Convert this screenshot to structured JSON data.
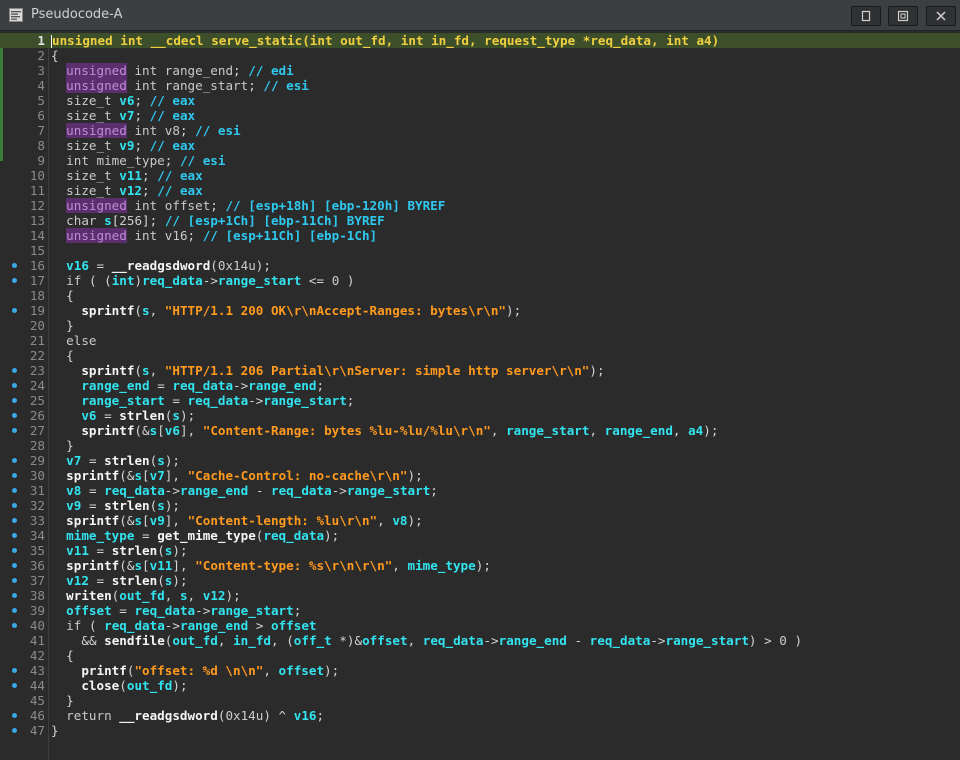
{
  "window": {
    "title": "Pseudocode-A",
    "icon": "pseudocode-window-icon",
    "buttons": [
      "restore-icon",
      "float-icon",
      "close-icon"
    ]
  },
  "editor": {
    "highlight_color": "#3d4e2a",
    "breakpoint_dot_color": "#3aa8e6",
    "lines": [
      {
        "n": 1,
        "dot": false,
        "text": "unsigned int __cdecl serve_static(int out_fd, int in_fd, request_type *req_data, int a4)"
      },
      {
        "n": 2,
        "dot": false,
        "text": "{"
      },
      {
        "n": 3,
        "dot": false,
        "text": "  unsigned int range_end; // edi"
      },
      {
        "n": 4,
        "dot": false,
        "text": "  unsigned int range_start; // esi"
      },
      {
        "n": 5,
        "dot": false,
        "text": "  size_t v6; // eax"
      },
      {
        "n": 6,
        "dot": false,
        "text": "  size_t v7; // eax"
      },
      {
        "n": 7,
        "dot": false,
        "text": "  unsigned int v8; // esi"
      },
      {
        "n": 8,
        "dot": false,
        "text": "  size_t v9; // eax"
      },
      {
        "n": 9,
        "dot": false,
        "text": "  int mime_type; // esi"
      },
      {
        "n": 10,
        "dot": false,
        "text": "  size_t v11; // eax"
      },
      {
        "n": 11,
        "dot": false,
        "text": "  size_t v12; // eax"
      },
      {
        "n": 12,
        "dot": false,
        "text": "  unsigned int offset; // [esp+18h] [ebp-120h] BYREF"
      },
      {
        "n": 13,
        "dot": false,
        "text": "  char s[256]; // [esp+1Ch] [ebp-11Ch] BYREF"
      },
      {
        "n": 14,
        "dot": false,
        "text": "  unsigned int v16; // [esp+11Ch] [ebp-1Ch]"
      },
      {
        "n": 15,
        "dot": false,
        "text": ""
      },
      {
        "n": 16,
        "dot": true,
        "text": "  v16 = __readgsdword(0x14u);"
      },
      {
        "n": 17,
        "dot": true,
        "text": "  if ( (int)req_data->range_start <= 0 )"
      },
      {
        "n": 18,
        "dot": false,
        "text": "  {"
      },
      {
        "n": 19,
        "dot": true,
        "text": "    sprintf(s, \"HTTP/1.1 200 OK\\r\\nAccept-Ranges: bytes\\r\\n\");"
      },
      {
        "n": 20,
        "dot": false,
        "text": "  }"
      },
      {
        "n": 21,
        "dot": false,
        "text": "  else"
      },
      {
        "n": 22,
        "dot": false,
        "text": "  {"
      },
      {
        "n": 23,
        "dot": true,
        "text": "    sprintf(s, \"HTTP/1.1 206 Partial\\r\\nServer: simple http server\\r\\n\");"
      },
      {
        "n": 24,
        "dot": true,
        "text": "    range_end = req_data->range_end;"
      },
      {
        "n": 25,
        "dot": true,
        "text": "    range_start = req_data->range_start;"
      },
      {
        "n": 26,
        "dot": true,
        "text": "    v6 = strlen(s);"
      },
      {
        "n": 27,
        "dot": true,
        "text": "    sprintf(&s[v6], \"Content-Range: bytes %lu-%lu/%lu\\r\\n\", range_start, range_end, a4);"
      },
      {
        "n": 28,
        "dot": false,
        "text": "  }"
      },
      {
        "n": 29,
        "dot": true,
        "text": "  v7 = strlen(s);"
      },
      {
        "n": 30,
        "dot": true,
        "text": "  sprintf(&s[v7], \"Cache-Control: no-cache\\r\\n\");"
      },
      {
        "n": 31,
        "dot": true,
        "text": "  v8 = req_data->range_end - req_data->range_start;"
      },
      {
        "n": 32,
        "dot": true,
        "text": "  v9 = strlen(s);"
      },
      {
        "n": 33,
        "dot": true,
        "text": "  sprintf(&s[v9], \"Content-length: %lu\\r\\n\", v8);"
      },
      {
        "n": 34,
        "dot": true,
        "text": "  mime_type = get_mime_type(req_data);"
      },
      {
        "n": 35,
        "dot": true,
        "text": "  v11 = strlen(s);"
      },
      {
        "n": 36,
        "dot": true,
        "text": "  sprintf(&s[v11], \"Content-type: %s\\r\\n\\r\\n\", mime_type);"
      },
      {
        "n": 37,
        "dot": true,
        "text": "  v12 = strlen(s);"
      },
      {
        "n": 38,
        "dot": true,
        "text": "  writen(out_fd, s, v12);"
      },
      {
        "n": 39,
        "dot": true,
        "text": "  offset = req_data->range_start;"
      },
      {
        "n": 40,
        "dot": true,
        "text": "  if ( req_data->range_end > offset"
      },
      {
        "n": 41,
        "dot": false,
        "text": "    && sendfile(out_fd, in_fd, (off_t *)&offset, req_data->range_end - req_data->range_start) > 0 )"
      },
      {
        "n": 42,
        "dot": false,
        "text": "  {"
      },
      {
        "n": 43,
        "dot": true,
        "text": "    printf(\"offset: %d \\n\\n\", offset);"
      },
      {
        "n": 44,
        "dot": true,
        "text": "    close(out_fd);"
      },
      {
        "n": 45,
        "dot": false,
        "text": "  }"
      },
      {
        "n": 46,
        "dot": true,
        "text": "  return __readgsdword(0x14u) ^ v16;"
      },
      {
        "n": 47,
        "dot": true,
        "text": "}"
      }
    ]
  }
}
